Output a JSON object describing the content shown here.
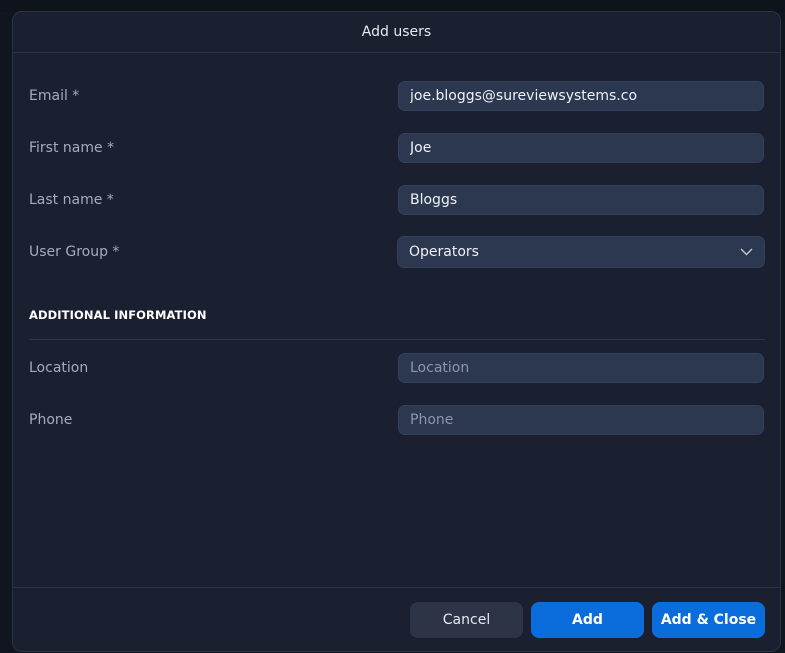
{
  "dialog": {
    "title": "Add users"
  },
  "form": {
    "email": {
      "label": "Email *",
      "value": "joe.bloggs@sureviewsystems.co",
      "placeholder": ""
    },
    "first_name": {
      "label": "First name *",
      "value": "Joe",
      "placeholder": ""
    },
    "last_name": {
      "label": "Last name *",
      "value": "Bloggs",
      "placeholder": ""
    },
    "user_group": {
      "label": "User Group *",
      "value": "Operators",
      "icon": "chevron-down-icon"
    }
  },
  "additional": {
    "title": "ADDITIONAL INFORMATION",
    "location": {
      "label": "Location",
      "value": "",
      "placeholder": "Location"
    },
    "phone": {
      "label": "Phone",
      "value": "",
      "placeholder": "Phone"
    }
  },
  "footer": {
    "cancel_label": "Cancel",
    "add_label": "Add",
    "add_close_label": "Add & Close"
  },
  "colors": {
    "primary": "#0b6ddc",
    "surface": "#1a2030",
    "field": "#2c3750"
  }
}
